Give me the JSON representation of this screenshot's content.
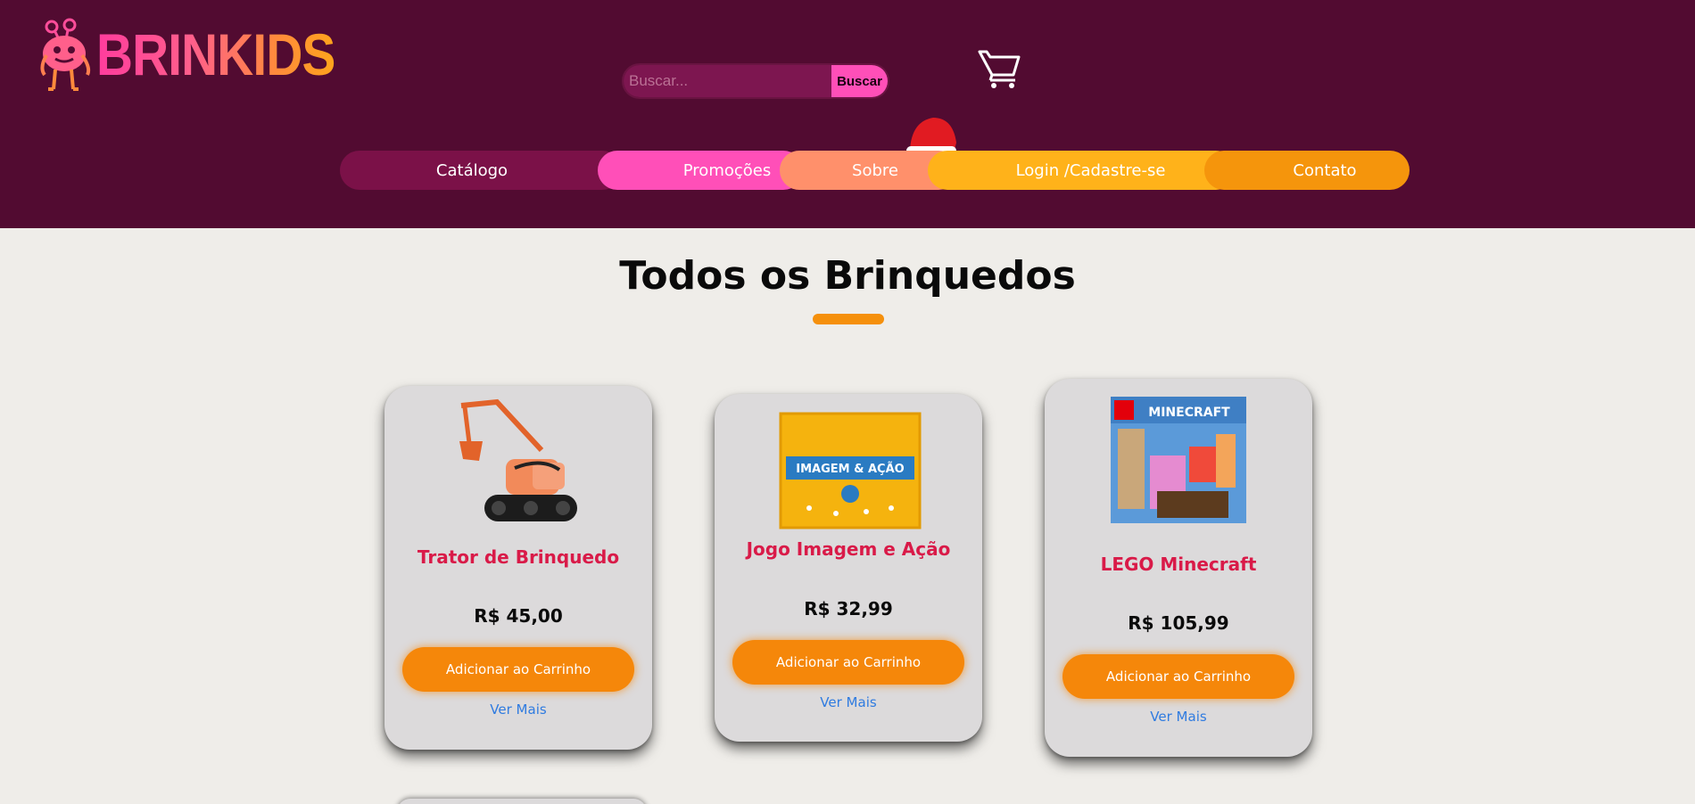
{
  "brand": {
    "name": "BRINKIDS"
  },
  "search": {
    "placeholder": "Buscar...",
    "button_label": "Buscar"
  },
  "nav": {
    "items": [
      {
        "label": "Catálogo"
      },
      {
        "label": "Promoções"
      },
      {
        "label": "Sobre"
      },
      {
        "label": "Login /Cadastre-se"
      },
      {
        "label": "Contato"
      }
    ]
  },
  "main": {
    "title": "Todos os Brinquedos"
  },
  "products": [
    {
      "name": "Trator de Brinquedo",
      "price": "R$ 45,00",
      "add_label": "Adicionar ao Carrinho",
      "more_label": "Ver Mais"
    },
    {
      "name": "Jogo Imagem e Ação",
      "price": "R$ 32,99",
      "add_label": "Adicionar ao Carrinho",
      "more_label": "Ver Mais"
    },
    {
      "name": "LEGO Minecraft",
      "price": "R$ 105,99",
      "add_label": "Adicionar ao Carrinho",
      "more_label": "Ver Mais"
    }
  ],
  "product_images": {
    "board_game_box_text": "IMAGEM & AÇÃO",
    "lego_box_text": "MINECRAFT"
  },
  "colors": {
    "header_bg": "#520b31",
    "page_bg": "#efede9",
    "accent_orange": "#f5870a",
    "accent_pink": "#ff4fb8",
    "product_name": "#d91a48",
    "link": "#2f7be0"
  }
}
